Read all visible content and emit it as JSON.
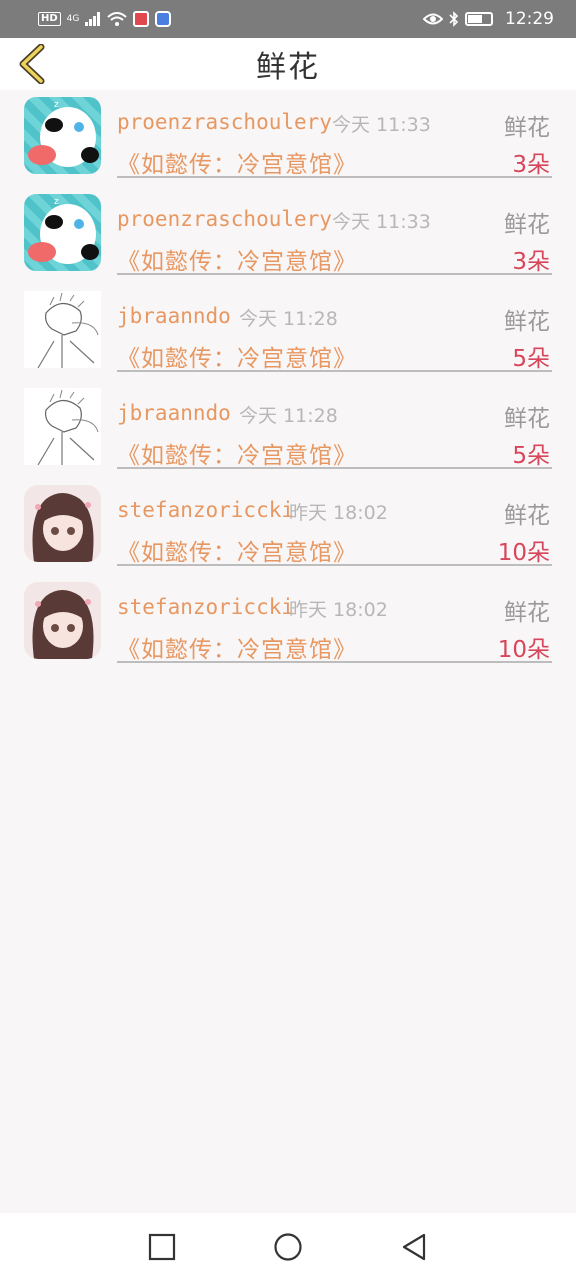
{
  "status_bar": {
    "left_labels": [
      "HD",
      "4G"
    ],
    "time": "12:29",
    "icons": [
      "hd-icon",
      "signal-icon",
      "wifi-icon",
      "reader-app-icon",
      "browser-app-icon",
      "eye-icon",
      "bluetooth-icon",
      "battery-icon"
    ]
  },
  "header": {
    "title": "鲜花",
    "back_icon": "chevron-left-icon"
  },
  "records": [
    {
      "avatar": "panda",
      "user": "proenzraschoulery",
      "time": "今天 11:33",
      "gift": "鲜花",
      "book": "《如懿传：冷宫意馆》",
      "count": "3朵"
    },
    {
      "avatar": "panda",
      "user": "proenzraschoulery",
      "time": "今天 11:33",
      "gift": "鲜花",
      "book": "《如懿传：冷宫意馆》",
      "count": "3朵"
    },
    {
      "avatar": "sketch",
      "user": "jbraanndo",
      "time": "今天 11:28",
      "gift": "鲜花",
      "book": "《如懿传：冷宫意馆》",
      "count": "5朵"
    },
    {
      "avatar": "sketch",
      "user": "jbraanndo",
      "time": "今天 11:28",
      "gift": "鲜花",
      "book": "《如懿传：冷宫意馆》",
      "count": "5朵"
    },
    {
      "avatar": "girl",
      "user": "stefanzoriccki",
      "time": "昨天 18:02",
      "gift": "鲜花",
      "book": "《如懿传：冷宫意馆》",
      "count": "10朵"
    },
    {
      "avatar": "girl",
      "user": "stefanzoriccki",
      "time": "昨天 18:02",
      "gift": "鲜花",
      "book": "《如懿传：冷宫意馆》",
      "count": "10朵"
    }
  ],
  "nav_bar": {
    "buttons": [
      "square-recents-icon",
      "circle-home-icon",
      "triangle-back-icon"
    ]
  },
  "colors": {
    "accent_orange": "#e79862",
    "count_red": "#d7465a",
    "back_arrow_yellow": "#f2d35a"
  }
}
